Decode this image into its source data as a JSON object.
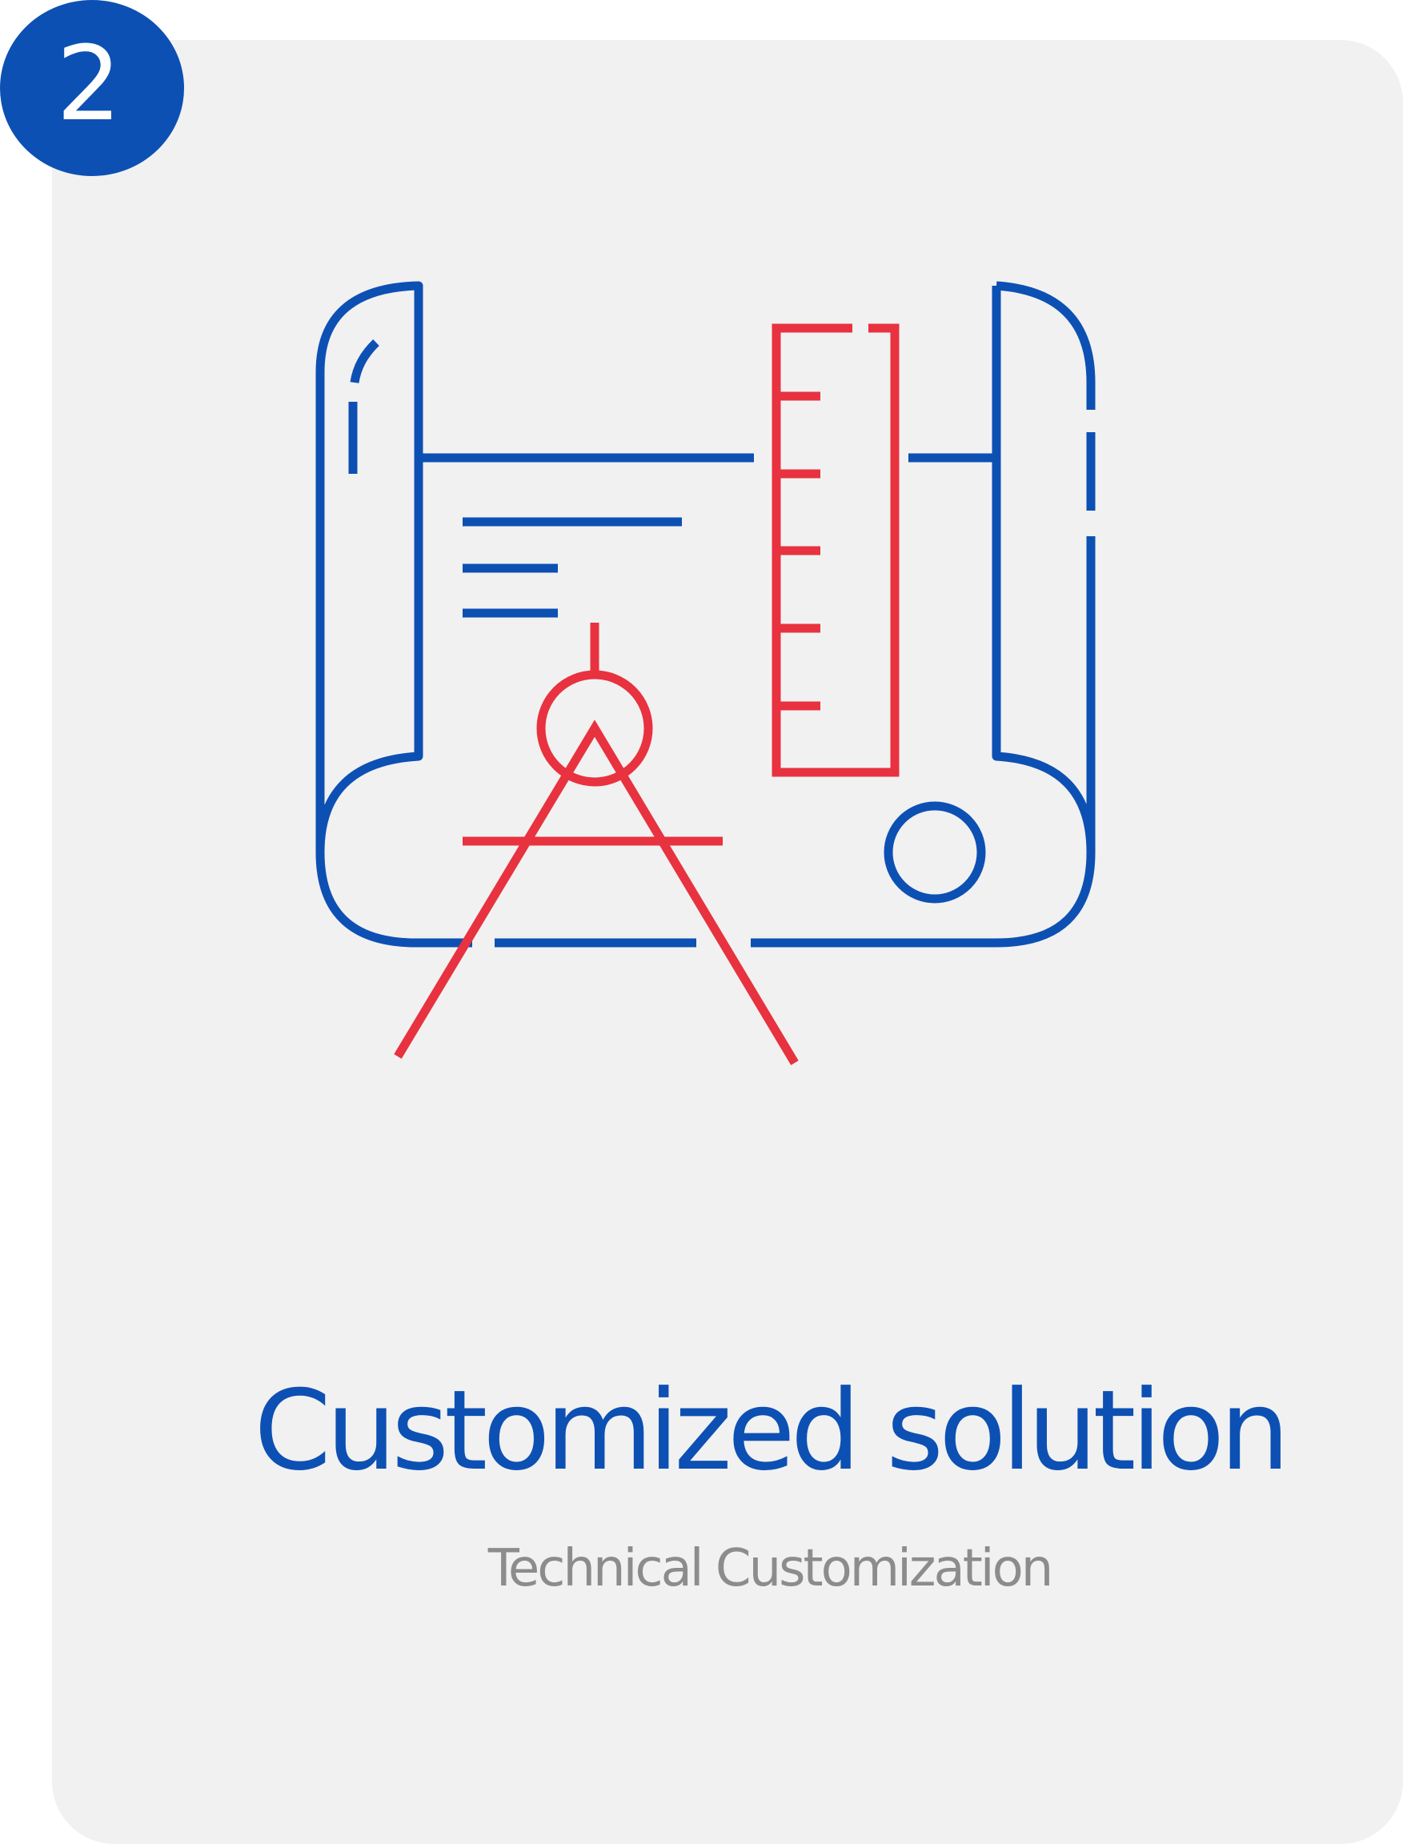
{
  "step": {
    "number": "2"
  },
  "card": {
    "title": "Customized solution",
    "subtitle": "Technical Customization"
  },
  "icon": {
    "name": "blueprint-compass-ruler-icon"
  },
  "colors": {
    "brand_blue": "#0d50b3",
    "accent_red": "#e8323f",
    "card_background": "#f1f1f1",
    "subtitle_gray": "#8c8c8c"
  }
}
